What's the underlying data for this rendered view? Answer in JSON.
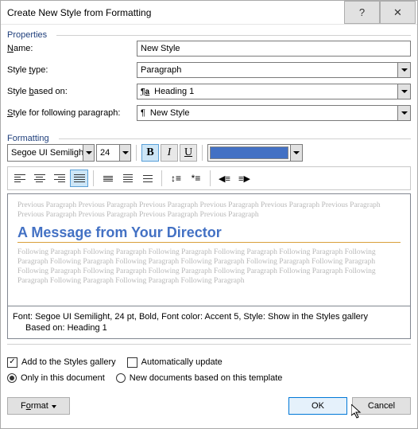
{
  "titlebar": {
    "title": "Create New Style from Formatting",
    "help": "?",
    "close": "✕"
  },
  "sections": {
    "properties": "Properties",
    "formatting": "Formatting"
  },
  "props": {
    "name_label_pre": "",
    "name_u": "N",
    "name_label_post": "ame:",
    "name_value": "New Style",
    "type_label_pre": "Style ",
    "type_u": "t",
    "type_label_post": "ype:",
    "type_value": "Paragraph",
    "based_label_pre": "Style ",
    "based_u": "b",
    "based_label_post": "ased on:",
    "based_value": "Heading 1",
    "follow_label_pre": "",
    "follow_u": "S",
    "follow_label_post": "tyle for following paragraph:",
    "follow_value": "New Style"
  },
  "toolbar": {
    "font": "Segoe UI Semiligh",
    "size": "24",
    "bold": "B",
    "italic": "I",
    "underline": "U",
    "color": "#4371c4"
  },
  "preview": {
    "prev": "Previous Paragraph Previous Paragraph Previous Paragraph Previous Paragraph Previous Paragraph Previous Paragraph Previous Paragraph Previous Paragraph Previous Paragraph Previous Paragraph",
    "sample": "A Message from Your Director",
    "foll": "Following Paragraph Following Paragraph Following Paragraph Following Paragraph Following Paragraph Following Paragraph Following Paragraph Following Paragraph Following Paragraph Following Paragraph Following Paragraph Following Paragraph Following Paragraph Following Paragraph Following Paragraph Following Paragraph Following Paragraph Following Paragraph Following Paragraph Following Paragraph"
  },
  "desc": {
    "line1": "Font: Segoe UI Semilight, 24 pt, Bold, Font color: Accent 5, Style: Show in the Styles gallery",
    "line2": "Based on: Heading 1"
  },
  "opts": {
    "add_u": "A",
    "add_post": "dd to the Styles gallery",
    "auto_pre": "A",
    "auto_u": "u",
    "auto_post": "tomatically update",
    "only_pre": "Only in this ",
    "only_u": "d",
    "only_post": "ocument",
    "newdoc": "New documents based on this template"
  },
  "buttons": {
    "format_pre": "F",
    "format_u": "o",
    "format_post": "rmat",
    "ok": "OK",
    "cancel": "Cancel"
  }
}
